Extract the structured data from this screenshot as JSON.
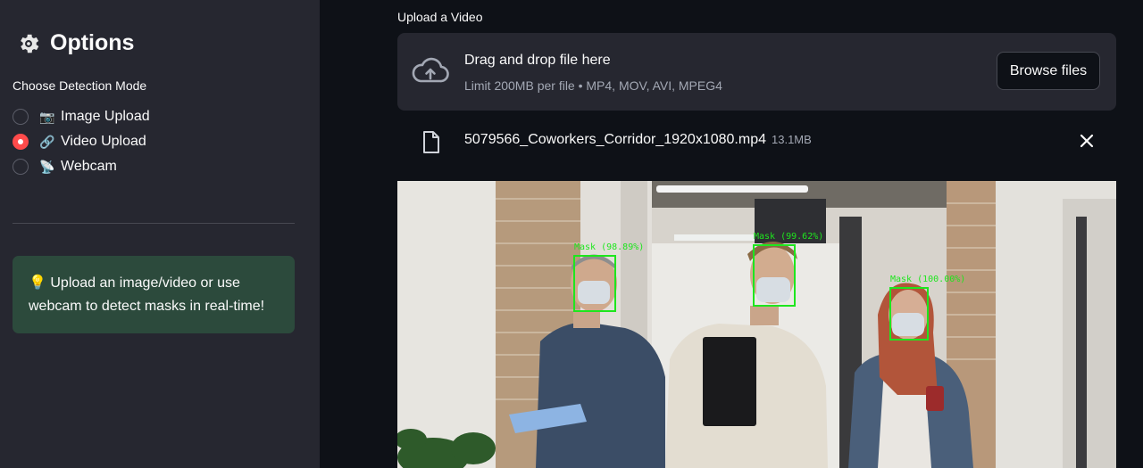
{
  "sidebar": {
    "title": "Options",
    "title_icon": "gear-icon",
    "mode_label": "Choose Detection Mode",
    "modes": [
      {
        "icon": "📷",
        "icon_name": "camera-icon",
        "label": "Image Upload",
        "selected": false
      },
      {
        "icon": "🔗",
        "icon_name": "link-icon",
        "label": "Video Upload",
        "selected": true
      },
      {
        "icon": "📡",
        "icon_name": "satellite-dish-icon",
        "label": "Webcam",
        "selected": false
      }
    ],
    "info": {
      "icon": "💡",
      "text": "Upload an image/video or use webcam to detect masks in real-time!"
    }
  },
  "main": {
    "upload_label": "Upload a Video",
    "dropzone": {
      "title": "Drag and drop file here",
      "subtitle": "Limit 200MB per file • MP4, MOV, AVI, MPEG4",
      "browse_label": "Browse files"
    },
    "file": {
      "name": "5079566_Coworkers_Corridor_1920x1080.mp4",
      "size": "13.1MB"
    },
    "video": {
      "detections": [
        {
          "label": "Mask (98.89%)"
        },
        {
          "label": "Mask (99.62%)"
        },
        {
          "label": "Mask (100.00%)"
        }
      ]
    }
  },
  "colors": {
    "accent": "#ff4b4b",
    "sidebar_bg": "#262730",
    "page_bg": "#0e1117",
    "info_bg": "#2c4a3c",
    "detection_box": "#1ee61e"
  }
}
